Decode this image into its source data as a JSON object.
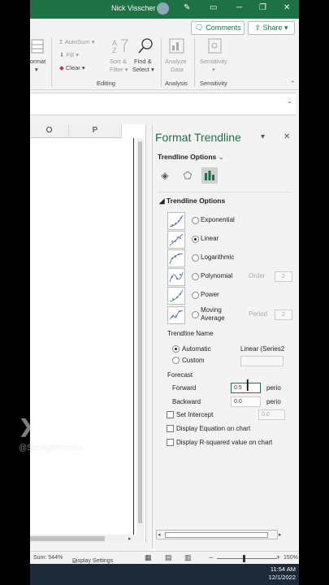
{
  "titlebar": {
    "user_name": "Nick Visscher"
  },
  "ribbon": {
    "comments_label": "Comments",
    "share_label": "Share",
    "format_partial": "ormat",
    "autosum": "AutoSum",
    "fill": "Fill",
    "clear": "Clear",
    "sort_filter_1": "Sort &",
    "sort_filter_2": "Filter",
    "find_select_1": "Find &",
    "find_select_2": "Select",
    "analyze_1": "Analyze",
    "analyze_2": "Data",
    "sensitivity": "Sensitivity",
    "group_editing": "Editing",
    "group_analysis": "Analysis",
    "group_sensitivity": "Sensitivity"
  },
  "grid": {
    "col_o": "O",
    "col_p": "P"
  },
  "pane": {
    "title": "Format Trendline",
    "options_dropdown": "Trendline Options",
    "section_title": "Trendline Options",
    "types": [
      {
        "label": "Exponential",
        "selected": false
      },
      {
        "label": "Linear",
        "selected": true
      },
      {
        "label": "Logarithmic",
        "selected": false
      },
      {
        "label": "Polynomial",
        "selected": false
      },
      {
        "label": "Power",
        "selected": false
      },
      {
        "label": "Moving Average",
        "selected": false
      }
    ],
    "order_label": "Order",
    "order_value": "2",
    "period_label": "Period",
    "period_value": "2",
    "name_section": "Trendline Name",
    "automatic_label": "Automatic",
    "automatic_value": "Linear (Series2",
    "custom_label": "Custom",
    "forecast_section": "Forecast",
    "forward_label": "Forward",
    "forward_value": "0.5",
    "forward_unit": "perio",
    "backward_label": "Backward",
    "backward_value": "0.0",
    "backward_unit": "perio",
    "set_intercept_label": "Set Intercept",
    "intercept_value": "0.0",
    "display_equation_label": "Display Equation on chart",
    "display_rsquared_label": "Display R-squared value on chart"
  },
  "status": {
    "sum": "Sum: 544%",
    "display_settings": "Display Settings",
    "zoom": "150%"
  },
  "taskbar": {
    "time": "11:54 AM",
    "date": "12/1/2022"
  },
  "watermark": {
    "handle": "@Spotlightimpact"
  },
  "colors": {
    "excel_green": "#1e7145",
    "taskbar": "#1c2a3a"
  }
}
